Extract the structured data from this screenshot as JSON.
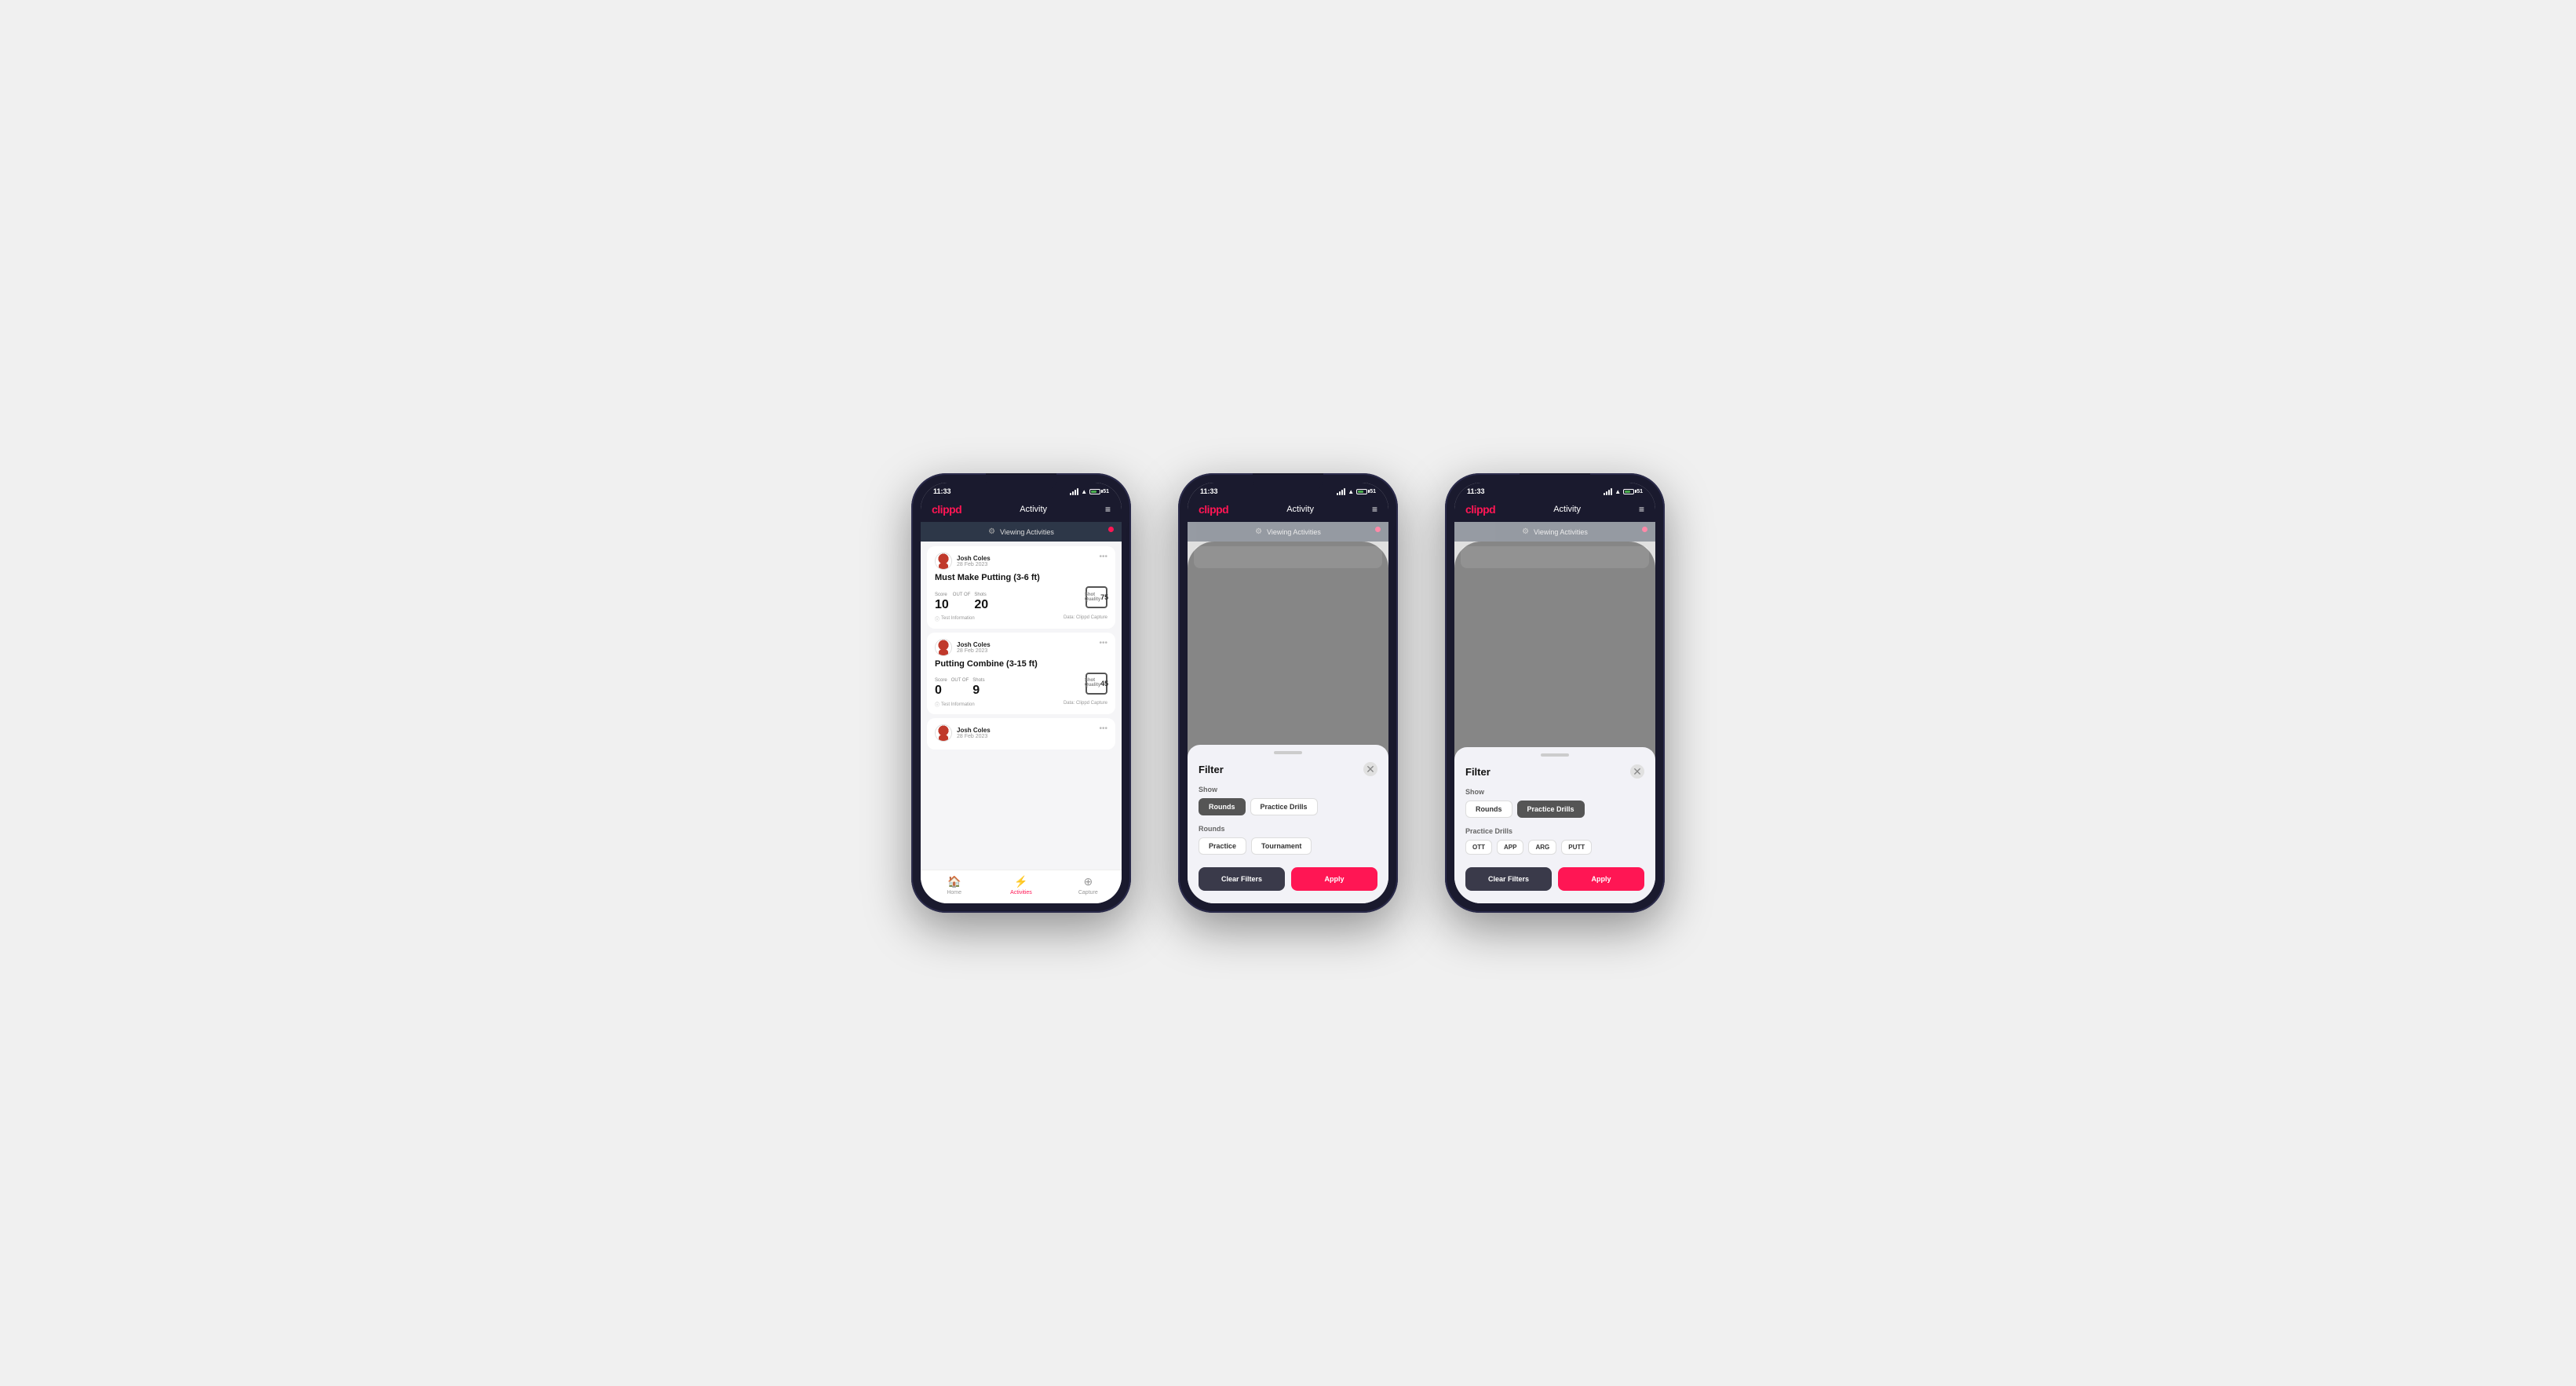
{
  "phones": [
    {
      "id": "phone1",
      "type": "activity-list",
      "statusBar": {
        "time": "11:33",
        "battery": "51"
      },
      "header": {
        "logo": "clippd",
        "title": "Activity",
        "menuIcon": "≡"
      },
      "viewingBar": {
        "text": "Viewing Activities"
      },
      "activities": [
        {
          "userName": "Josh Coles",
          "date": "28 Feb 2023",
          "title": "Must Make Putting (3-6 ft)",
          "score": "10",
          "outOf": "OUT OF",
          "shots": "20",
          "shotQualityLabel": "Shot Quality",
          "shotQuality": "75",
          "testInfo": "Test Information",
          "dataSource": "Data: Clippd Capture"
        },
        {
          "userName": "Josh Coles",
          "date": "28 Feb 2023",
          "title": "Putting Combine (3-15 ft)",
          "score": "0",
          "outOf": "OUT OF",
          "shots": "9",
          "shotQualityLabel": "Shot Quality",
          "shotQuality": "45",
          "testInfo": "Test Information",
          "dataSource": "Data: Clippd Capture"
        },
        {
          "userName": "Josh Coles",
          "date": "28 Feb 2023",
          "title": "",
          "score": "",
          "outOf": "",
          "shots": "",
          "shotQualityLabel": "",
          "shotQuality": "",
          "testInfo": "",
          "dataSource": ""
        }
      ],
      "bottomNav": {
        "items": [
          {
            "icon": "🏠",
            "label": "Home",
            "active": false
          },
          {
            "icon": "⚡",
            "label": "Activities",
            "active": true
          },
          {
            "icon": "⊕",
            "label": "Capture",
            "active": false
          }
        ]
      }
    },
    {
      "id": "phone2",
      "type": "filter-rounds",
      "statusBar": {
        "time": "11:33",
        "battery": "51"
      },
      "header": {
        "logo": "clippd",
        "title": "Activity",
        "menuIcon": "≡"
      },
      "viewingBar": {
        "text": "Viewing Activities"
      },
      "filter": {
        "title": "Filter",
        "showLabel": "Show",
        "showButtons": [
          {
            "label": "Rounds",
            "active": true
          },
          {
            "label": "Practice Drills",
            "active": false
          }
        ],
        "roundsLabel": "Rounds",
        "roundsButtons": [
          {
            "label": "Practice",
            "active": false
          },
          {
            "label": "Tournament",
            "active": false
          }
        ],
        "clearLabel": "Clear Filters",
        "applyLabel": "Apply"
      }
    },
    {
      "id": "phone3",
      "type": "filter-drills",
      "statusBar": {
        "time": "11:33",
        "battery": "51"
      },
      "header": {
        "logo": "clippd",
        "title": "Activity",
        "menuIcon": "≡"
      },
      "viewingBar": {
        "text": "Viewing Activities"
      },
      "filter": {
        "title": "Filter",
        "showLabel": "Show",
        "showButtons": [
          {
            "label": "Rounds",
            "active": false
          },
          {
            "label": "Practice Drills",
            "active": true
          }
        ],
        "drillsLabel": "Practice Drills",
        "drillsButtons": [
          {
            "label": "OTT",
            "active": false
          },
          {
            "label": "APP",
            "active": false
          },
          {
            "label": "ARG",
            "active": false
          },
          {
            "label": "PUTT",
            "active": false
          }
        ],
        "clearLabel": "Clear Filters",
        "applyLabel": "Apply"
      }
    }
  ]
}
